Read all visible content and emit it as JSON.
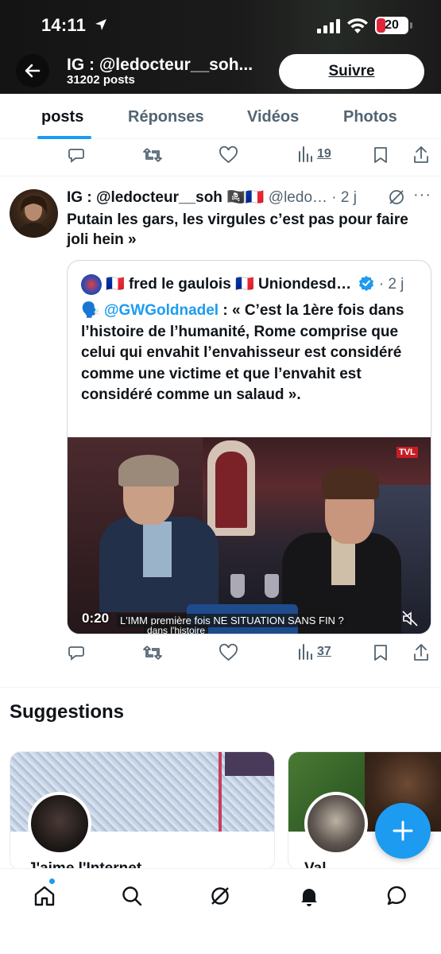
{
  "status_bar": {
    "time": "14:11",
    "battery_level": "20",
    "icons": [
      "location-arrow-icon",
      "signal-icon",
      "wifi-icon",
      "battery-icon"
    ]
  },
  "header": {
    "profile_name": "IG : @ledocteur__soh...",
    "post_count": "31202 posts",
    "follow_label": "Suivre"
  },
  "tabs": [
    {
      "label": "posts",
      "active": true
    },
    {
      "label": "Réponses",
      "active": false
    },
    {
      "label": "Vidéos",
      "active": false
    },
    {
      "label": "Photos",
      "active": false
    }
  ],
  "prev_post_actions": {
    "views": "19"
  },
  "post": {
    "author": "IG : @ledocteur__soh",
    "emoji": "🏴‍☠️🇫🇷",
    "handle": "@ledo…",
    "time": "· 2 j",
    "text": "Putain les gars, les virgules c’est pas pour faire joli hein »",
    "quote": {
      "flag_left": "🇫🇷",
      "author": "fred le gaulois",
      "flag_right": "🇫🇷",
      "author_tail": "Uniondesd…",
      "time": "· 2 j",
      "speaker": "🗣️",
      "mention": "@GWGoldnadel",
      "text": " : « C’est la 1ère fois dans l’histoire de l’humanité, Rome comprise que celui qui envahit l’envahisseur est considéré comme une victime et que l’envahit est considéré comme un salaud ».",
      "video": {
        "timestamp": "0:20",
        "caption": "L'IMM première fois NE SITUATION SANS FIN ?",
        "sub_caption": "dans l'histoire",
        "channel_logo": "TVL"
      }
    },
    "views": "37"
  },
  "suggestions": {
    "title": "Suggestions",
    "cards": [
      {
        "name": "J'aime l'Internet"
      },
      {
        "name": "Val"
      }
    ]
  },
  "colors": {
    "accent": "#1d9bf0",
    "text": "#0f1419",
    "secondary": "#536471",
    "battery_low": "#e0243a"
  },
  "bottom_nav": [
    "home-icon",
    "search-icon",
    "grok-icon",
    "notifications-icon",
    "messages-icon"
  ]
}
